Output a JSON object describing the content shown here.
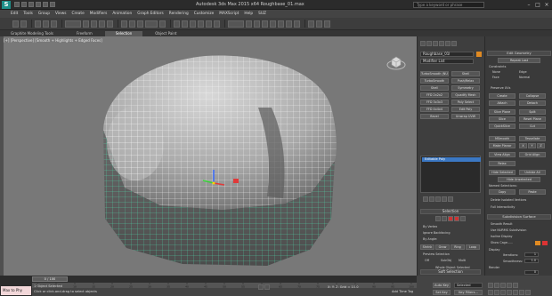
{
  "app": {
    "title": "Autodesk 3ds Max 2015 x64     Roughbase_01.max",
    "logo_letter": "S",
    "search_placeholder": "Type a keyword or phrase"
  },
  "menu": [
    "Edit",
    "Tools",
    "Group",
    "Views",
    "Create",
    "Modifiers",
    "Animation",
    "Graph Editors",
    "Rendering",
    "Customize",
    "MAXScript",
    "Help",
    "SUZ"
  ],
  "ribbon_tabs": [
    {
      "label": "Graphite Modeling Tools",
      "active": false
    },
    {
      "label": "Freeform",
      "active": false
    },
    {
      "label": "Selection",
      "active": true
    },
    {
      "label": "Object Paint",
      "active": false
    }
  ],
  "viewport": {
    "label": "[+] [Perspective] [Smooth + Highlights + Edged Faces]",
    "background": "#787878"
  },
  "command_panel": {
    "object_name": "Roughbase_01l",
    "object_color": "#e08a22",
    "modifier_list": "Modifier List",
    "buttons": [
      "TurboSmooth (NURBS)",
      "Shell",
      "TurboSmooth",
      "Push/Relax",
      "Shell",
      "Symmetry",
      "FFD 2x2x2",
      "Quadify Mesh",
      "FFD 3x3x3",
      "Poly Select",
      "FFD 4x4x4",
      "Edit Poly",
      "Bevel",
      "Unwrap UVW"
    ],
    "stack_item": "Editable Poly",
    "selection_head": "Selection",
    "selection_opts": [
      "By Vertex",
      "Ignore Backfacing",
      "By Angle:",
      "Shrink",
      "Grow",
      "Ring",
      "Loop"
    ],
    "preview_selection": "Preview Selection",
    "preview_opts": [
      "Off",
      "SubObj",
      "Multi"
    ],
    "whole_selected": "Whole Object Selected",
    "soft_selection": "Soft Selection"
  },
  "right_panel": {
    "edit_geometry": "Edit Geometry",
    "repeat_last": "Repeat Last",
    "constraints": "Constraints",
    "constraint_opts": [
      "None",
      "Edge",
      "Face",
      "Normal"
    ],
    "preserve_uvs": "Preserve UVs",
    "buttons": [
      "Create",
      "Collapse",
      "Attach",
      "Detach",
      "Slice Plane",
      "Split",
      "Slice",
      "Reset Plane",
      "QuickSlice",
      "Cut",
      "MSmooth",
      "Tessellate",
      "Make Planar",
      "X",
      "Y",
      "Z",
      "View Align",
      "Grid Align",
      "Relax",
      "Hide Selected",
      "Unhide All",
      "Hide Unselected"
    ],
    "named_selections": "Named Selections:",
    "copy": "Copy",
    "paste": "Paste",
    "delete_isolated": "Delete Isolated Vertices",
    "full_interactivity": "Full Interactivity",
    "subdivision_surface": "Subdivision Surface",
    "smooth_result": "Smooth Result",
    "use_nurms": "Use NURMS Subdivision",
    "isoline_display": "Isoline Display",
    "show_cage": "Show Cage......",
    "display": "Display",
    "iterations_label": "Iterations:",
    "iterations_value": "1",
    "smoothness_label": "Smoothness:",
    "smoothness_value": "1.0",
    "render": "Render",
    "render_iterations_value": "0"
  },
  "timeline": {
    "frame": "0 / 100",
    "ticks": [
      "0",
      "5",
      "10",
      "15",
      "20",
      "25",
      "30",
      "35",
      "40",
      "45",
      "50",
      "55",
      "60",
      "65",
      "70",
      "75",
      "80",
      "85",
      "90",
      "95",
      "100"
    ]
  },
  "status": {
    "maxscript_label": "Max to Phy",
    "line1": "1 Object Selected",
    "line2": "Click or click-and-drag to select objects",
    "coords": "X:   Y:   Z:   Grid = 10.0",
    "add_time_tag": "Add Time Tag",
    "auto_key": "Auto Key",
    "selected": "Selected",
    "set_key": "Set Key",
    "key_filters": "Key Filters..."
  }
}
